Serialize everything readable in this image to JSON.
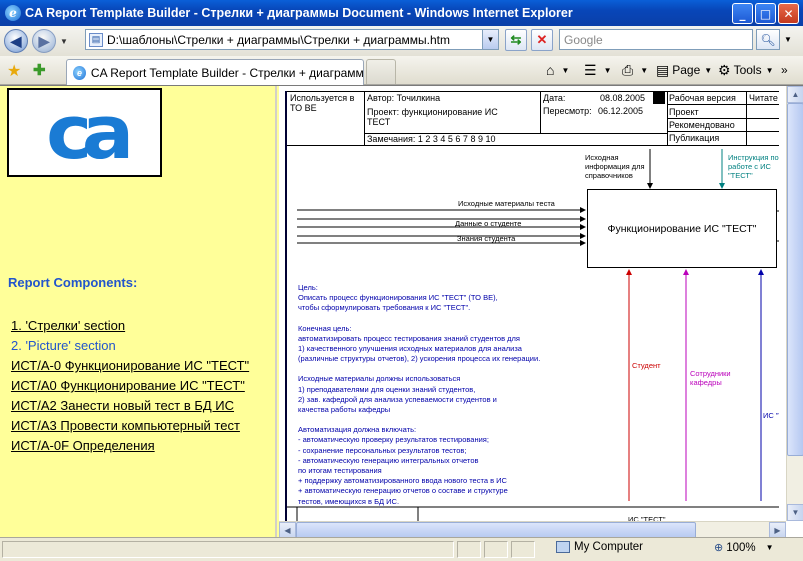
{
  "window": {
    "title": "CA Report Template Builder - Стрелки + диаграммы Document - Windows Internet Explorer",
    "buttons": {
      "minimize": "_",
      "maximize": "□",
      "close": "✕"
    }
  },
  "toolbar": {
    "address": "D:\\шаблоны\\Стрелки + диаграммы\\Стрелки + диаграммы.htm",
    "search_placeholder": "Google"
  },
  "tabs": [
    {
      "label": "CA Report Template Builder - Стрелки + диаграммы ..."
    }
  ],
  "commands": {
    "page": "Page",
    "tools": "Tools"
  },
  "left_pane": {
    "logo_text": "ca",
    "heading": "Report Components:",
    "links": [
      {
        "label": "1. 'Стрелки' section",
        "current": false
      },
      {
        "label": "2. 'Picture' section",
        "current": true
      },
      {
        "label": "ИСТ/А-0 Функционирование ИС \"ТЕСТ\"",
        "current": false
      },
      {
        "label": "ИСТ/А0 Функционирование ИС \"ТЕСТ\"",
        "current": false
      },
      {
        "label": "ИСТ/А2 Занести новый тест в БД ИС",
        "current": false
      },
      {
        "label": "ИСТ/А3 Провести компьютерный тест",
        "current": false
      },
      {
        "label": "ИСТ/А-0F Определения",
        "current": false
      }
    ]
  },
  "diagram": {
    "header": {
      "used_at": "Используется в",
      "used_at_value": "ТО ВЕ",
      "author": "Автор:  Точилкина",
      "project": "Проект:  функционирование ИС",
      "project_cont": "ТЕСТ",
      "notes": "Замечания:  1  2  3  4  5  6  7  8  9  10",
      "date_label": "Дата:",
      "date_value": "08.08.2005",
      "rev_label": "Пересмотр:",
      "rev_value": "06.12.2005",
      "status": [
        "Рабочая версия",
        "Проект",
        "Рекомендовано",
        "Публикация"
      ],
      "reader": "Читате"
    },
    "function_box": "Функционирование ИС \"ТЕСТ\"",
    "inputs": [
      "Исходные материалы теста",
      "Данные о студенте",
      "Знания студента"
    ],
    "controls": [
      "Исходная информация для справочников",
      "Инструкция по работе с ИС \"ТЕСТ\""
    ],
    "mechanisms": [
      "Студент",
      "Сотрудники кафедры",
      "ИС \"Т"
    ],
    "bottom_cut": "ИС \"ТЕСТ\"",
    "description": [
      "Цель:",
      "Описать процесс функционирования ИС \"ТЕСТ\" (ТО ВЕ),",
      "чтобы сформулировать требования к ИС \"ТЕСТ\".",
      "",
      "Конечная цель:",
      "автоматизировать процесс тестирования знаний студентов для",
      "1) качественного улучшения исходных материалов для анализа",
      "(различные структуры отчетов), 2) ускорения процесса их генерации.",
      "",
      "Исходные материалы должны использоваться",
      "1) преподавателями для оценки знаний студентов,",
      "2) зав. кафедрой для анализа успеваемости студентов и",
      "качества работы кафедры",
      "",
      "Автоматизация должна включать:",
      "- автоматическую проверку результатов тестирования;",
      "- сохранение персональных результатов тестов;",
      "- автоматическую генерацию интегральных отчетов",
      "  по итогам тестирования",
      "+ поддержку автоматизированного ввода нового теста в ИС",
      "+ автоматическую генерацию отчетов о составе и структуре",
      "тестов, имеющихся в БД ИС."
    ]
  },
  "status_bar": {
    "zone": "My Computer",
    "zoom": "100%"
  },
  "colors": {
    "left_bg": "#ffff99",
    "link_current": "#2255cc",
    "student_arrow": "#cc0000",
    "staff_arrow": "#bb00bb",
    "system_arrow": "#0000aa",
    "instruction_arrow": "#008080"
  }
}
